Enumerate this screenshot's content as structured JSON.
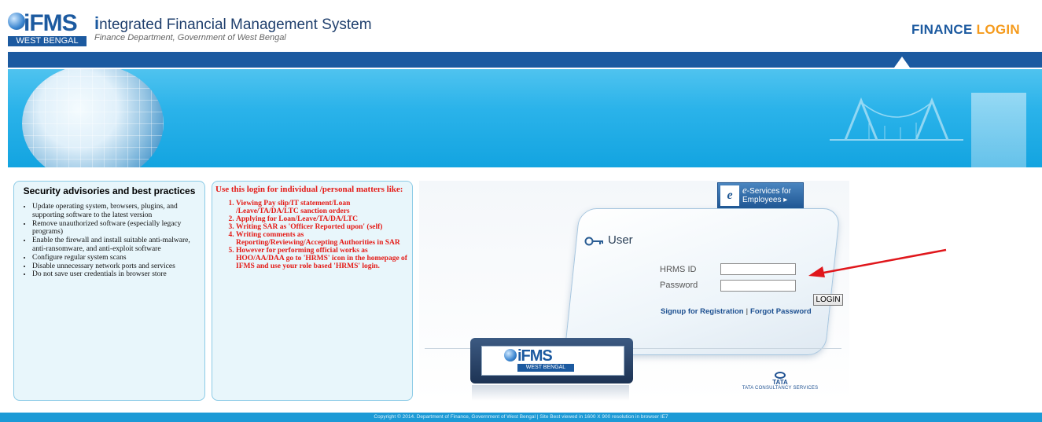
{
  "header": {
    "logo_text": "iFMS",
    "logo_region": "WEST BENGAL",
    "title_first_letter": "i",
    "title_rest": "ntegrated Financial Management System",
    "subtitle": "Finance Department, Government of West Bengal",
    "finance_word": "FINANCE",
    "login_word": "LOGIN"
  },
  "security_panel": {
    "title": "Security advisories and best practices",
    "items": [
      "Update operating system, browsers, plugins, and supporting software to the latest version",
      "Remove unauthorized software (especially legacy programs)",
      "Enable the firewall and install suitable anti-malware, anti-ransomware, and anti-exploit software",
      "Configure regular system scans",
      "Disable unnecessary network ports and services",
      "Do not save user credentials in browser store"
    ]
  },
  "usage_panel": {
    "heading": "Use this login for individual /personal matters like:",
    "items": [
      "Viewing Pay slip/IT statement/Loan /Leave/TA/DA/LTC sanction orders",
      "Applying for Loan/Leave/TA/DA/LTC",
      "Writing SAR as 'Officer Reported upon' (self)",
      "Writing comments as Reporting/Reviewing/Accepting Authorities in SAR",
      "However for performing official works as HOO/AA/DAA go to 'HRMS' icon in the homepage of IFMS and use your role based 'HRMS' login."
    ]
  },
  "eservices": {
    "icon_letter": "e",
    "prefix": "e",
    "line1": "-Services for",
    "line2": "Employees ▸"
  },
  "login": {
    "user_label": "User",
    "hrms_label": "HRMS ID",
    "password_label": "Password",
    "hrms_value": "",
    "password_value": "",
    "login_button": "LOGIN",
    "signup_link": "Signup for Registration",
    "separator": "|",
    "forgot_link": "Forgot Password"
  },
  "device_logo": {
    "text": "iFMS",
    "region": "WEST BENGAL"
  },
  "tata": {
    "word": "TATA",
    "services": "TATA CONSULTANCY SERVICES"
  },
  "footer": {
    "text": "Copyright © 2014. Department of Finance, Government of West Bengal | Site Best viewed in 1600 X 900 resolution in browser IE7"
  },
  "colors": {
    "brand_blue": "#1c5aa0",
    "accent_orange": "#f59a1b",
    "alert_red": "#e41b17",
    "annotation_arrow": "#e0161b"
  }
}
